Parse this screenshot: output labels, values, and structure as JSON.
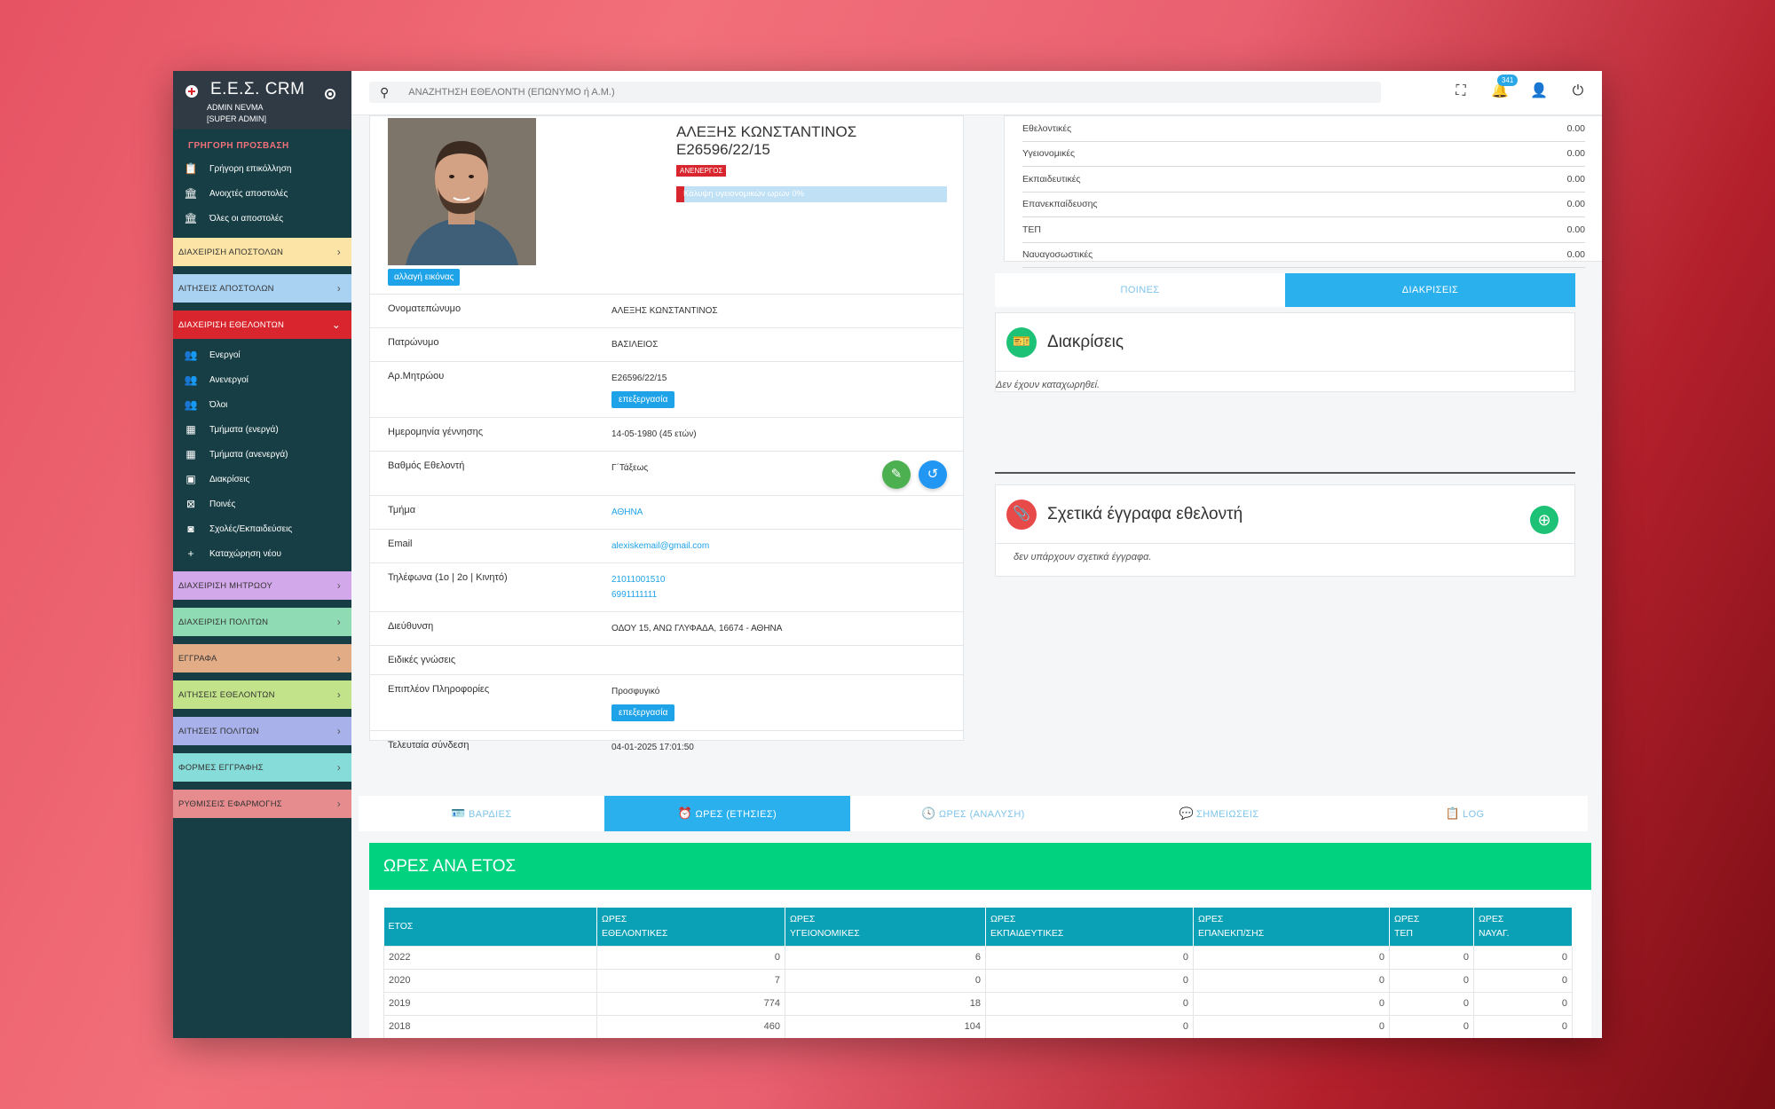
{
  "brand": {
    "title": "Ε.Ε.Σ. CRM",
    "user_name": "ADMIN NEVMA",
    "user_role": "[SUPER ADMIN]"
  },
  "sidebar": {
    "quick_title": "ΓΡΗΓΟΡΗ ΠΡΟΣΒΑΣΗ",
    "quick_links": [
      {
        "label": "Γρήγορη επικόλληση",
        "icon": "clipboard-icon"
      },
      {
        "label": "Ανοιχτές αποστολές",
        "icon": "bank-icon"
      },
      {
        "label": "Όλες οι αποστολές",
        "icon": "bank-icon"
      }
    ],
    "sections": [
      {
        "label": "ΔΙΑΧΕΙΡΙΣΗ ΑΠΟΣΤΟΛΩΝ",
        "color": "#fbe4a6"
      },
      {
        "label": "ΑΙΤΗΣΕΙΣ ΑΠΟΣΤΟΛΩΝ",
        "color": "#a9d2f2"
      },
      {
        "label": "ΔΙΑΧΕΙΡΙΣΗ ΕΘΕΛΟΝΤΩΝ",
        "color": "#d9262e"
      }
    ],
    "volunteer_links": [
      {
        "label": "Ενεργοί",
        "icon": "users-icon"
      },
      {
        "label": "Ανενεργοί",
        "icon": "users-icon"
      },
      {
        "label": "Όλοι",
        "icon": "users-icon"
      },
      {
        "label": "Τμήματα (ενεργά)",
        "icon": "building-icon"
      },
      {
        "label": "Τμήματα (ανενεργά)",
        "icon": "building-icon"
      },
      {
        "label": "Διακρίσεις",
        "icon": "award-icon"
      },
      {
        "label": "Ποινές",
        "icon": "calendar-x-icon"
      },
      {
        "label": "Σχολές/Εκπαιδεύσεις",
        "icon": "bookmark-icon"
      },
      {
        "label": "Καταχώρηση νέου",
        "icon": "plus-icon"
      }
    ],
    "sections_bottom": [
      {
        "label": "ΔΙΑΧΕΙΡΙΣΗ ΜΗΤΡΩΟΥ",
        "color": "#d3a8ea"
      },
      {
        "label": "ΔΙΑΧΕΙΡΙΣΗ ΠΟΛΙΤΩΝ",
        "color": "#8fdcb4"
      },
      {
        "label": "ΕΓΓΡΑΦΑ",
        "color": "#e2ac86"
      },
      {
        "label": "ΑΙΤΗΣΕΙΣ ΕΘΕΛΟΝΤΩΝ",
        "color": "#c3e38a"
      },
      {
        "label": "ΑΙΤΗΣΕΙΣ ΠΟΛΙΤΩΝ",
        "color": "#a8b1ea"
      },
      {
        "label": "ΦΟΡΜΕΣ ΕΓΓΡΑΦΗΣ",
        "color": "#86dcd8"
      },
      {
        "label": "ΡΥΘΜΙΣΕΙΣ ΕΦΑΡΜΟΓΗΣ",
        "color": "#e68c8e"
      }
    ]
  },
  "search": {
    "placeholder": "ΑΝΑΖΗΤΗΣΗ ΕΘΕΛΟΝΤΗ (ΕΠΩΝΥΜΟ ή Α.Μ.)"
  },
  "topbar": {
    "notifications": "341"
  },
  "profile": {
    "name": "ΑΛΕΞΗΣ ΚΩΝΣΤΑΝΤΙΝΟΣ",
    "registry": "Ε26596/22/15",
    "status": "ΑΝΕΝΕΡΓΟΣ",
    "coverage_label": "Κάλυψη υγειονομικών ωρών 0%",
    "coverage_fraction": 0.03,
    "change_image": "αλλαγή εικόνας",
    "edit_label": "επεξεργασία",
    "fields": {
      "fullname_label": "Ονοματεπώνυμο",
      "fullname": "ΑΛΕΞΗΣ ΚΩΝΣΤΑΝΤΙΝΟΣ",
      "father_label": "Πατρώνυμο",
      "father": "ΒΑΣΙΛΕΙΟΣ",
      "registry_label": "Αρ.Μητρώου",
      "registry": "Ε26596/22/15",
      "birth_label": "Ημερομηνία γέννησης",
      "birth": "14-05-1980 (45 ετών)",
      "rank_label": "Βαθμός Εθελοντή",
      "rank": "Γ΄Τάξεως",
      "dept_label": "Τμήμα",
      "dept": "ΑΘΗΝΑ",
      "email_label": "Email",
      "email": "alexiskemail@gmail.com",
      "phones_label": "Τηλέφωνα (1ο | 2ο | Κινητό)",
      "phone1": "21011001510",
      "phone2": "6991111111",
      "address_label": "Διεύθυνση",
      "address": "ΟΔΟΥ 15, ΑΝΩ ΓΛΥΦΑΔΑ, 16674 - ΑΘΗΝΑ",
      "skills_label": "Ειδικές γνώσεις",
      "skills": "",
      "extra_label": "Επιπλέον Πληροφορίες",
      "extra": "Προσφυγικό",
      "lastlogin_label": "Τελευταία σύνδεση",
      "lastlogin": "04-01-2025 17:01:50"
    }
  },
  "hours_summary": [
    {
      "label": "Εθελοντικές",
      "value": "0.00"
    },
    {
      "label": "Υγειονομικές",
      "value": "0.00"
    },
    {
      "label": "Εκπαιδευτικές",
      "value": "0.00"
    },
    {
      "label": "Επανεκπαίδευσης",
      "value": "0.00"
    },
    {
      "label": "ΤΕΠ",
      "value": "0.00"
    },
    {
      "label": "Ναυαγοσωστικές",
      "value": "0.00"
    }
  ],
  "tabs_right": {
    "penalties": "ΠΟΙΝΕΣ",
    "distinctions": "ΔΙΑΚΡΙΣΕΙΣ"
  },
  "distinctions": {
    "title": "Διακρίσεις",
    "empty": "Δεν έχουν καταχωρηθεί."
  },
  "documents": {
    "title": "Σχετικά έγγραφα εθελοντή",
    "empty": "δεν υπάρχουν σχετικά έγγραφα."
  },
  "bottom_tabs": [
    {
      "label": "ΒΑΡΔΙΕΣ",
      "icon": "badge-icon"
    },
    {
      "label": "ΩΡΕΣ (ΕΤΗΣΙΕΣ)",
      "icon": "alarm-icon"
    },
    {
      "label": "ΩΡΕΣ (ΑΝΑΛΥΣΗ)",
      "icon": "clock-icon"
    },
    {
      "label": "ΣΗΜΕΙΩΣΕΙΣ",
      "icon": "comment-icon"
    },
    {
      "label": "LOG",
      "icon": "clipboard-icon"
    }
  ],
  "year_hours": {
    "title": "ΩΡΕΣ ΑΝΑ ΕΤΟΣ",
    "headers": [
      [
        "ΕΤΟΣ",
        ""
      ],
      [
        "ΩΡΕΣ",
        "ΕΘΕΛΟΝΤΙΚΕΣ"
      ],
      [
        "ΩΡΕΣ",
        "ΥΓΕΙΟΝΟΜΙΚΕΣ"
      ],
      [
        "ΩΡΕΣ",
        "ΕΚΠΑΙΔΕΥΤΙΚΕΣ"
      ],
      [
        "ΩΡΕΣ",
        "ΕΠΑΝΕΚΠ/ΣΗΣ"
      ],
      [
        "ΩΡΕΣ",
        "ΤΕΠ"
      ],
      [
        "ΩΡΕΣ",
        "ΝΑΥΑΓ."
      ]
    ],
    "rows": [
      [
        "2022",
        "0",
        "6",
        "0",
        "0",
        "0",
        "0"
      ],
      [
        "2020",
        "7",
        "0",
        "0",
        "0",
        "0",
        "0"
      ],
      [
        "2019",
        "774",
        "18",
        "0",
        "0",
        "0",
        "0"
      ],
      [
        "2018",
        "460",
        "104",
        "0",
        "0",
        "0",
        "0"
      ]
    ]
  }
}
